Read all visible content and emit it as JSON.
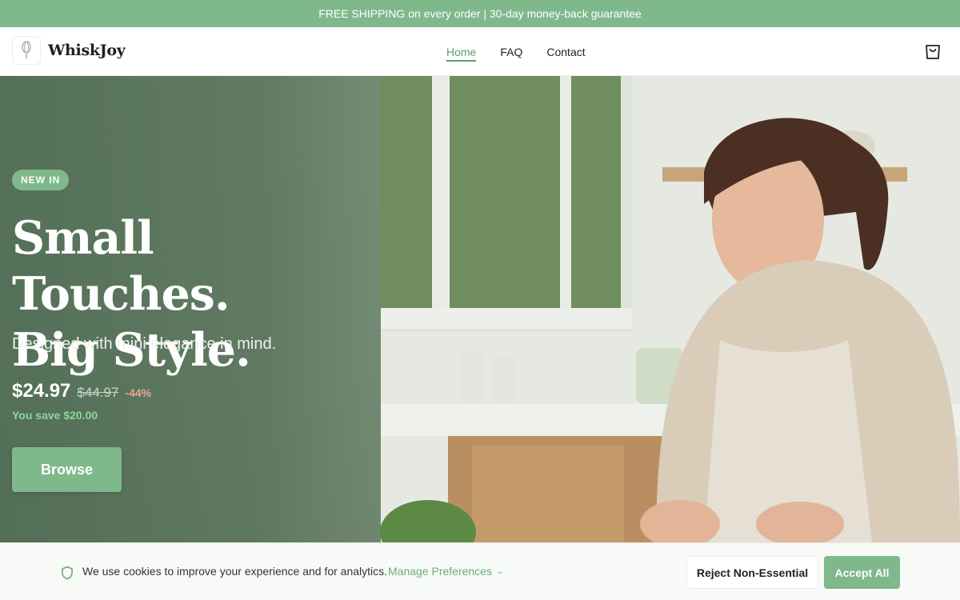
{
  "announcement": "FREE SHIPPING on every order | 30-day money-back guarantee",
  "header": {
    "brand": "WhiskJoy",
    "logo_icon": "whisk-icon",
    "nav": [
      {
        "label": "Home",
        "active": true
      },
      {
        "label": "FAQ",
        "active": false
      },
      {
        "label": "Contact",
        "active": false
      }
    ],
    "cart_icon": "shopping-bag-icon"
  },
  "hero": {
    "badge": "NEW IN",
    "headline_line1": "Small Touches.",
    "headline_line2": "Big Style.",
    "subhead": "Designed with mini elegance in mind.",
    "price_now": "$24.97",
    "price_was": "$44.97",
    "discount": "-44%",
    "saving": "You save $20.00",
    "cta": "Browse"
  },
  "cookie": {
    "icon": "shield-icon",
    "text": "We use cookies to improve your experience and for analytics.",
    "manage": "Manage Preferences",
    "reject": "Reject Non-Essential",
    "accept": "Accept All"
  },
  "colors": {
    "accent": "#7fb88b",
    "accent_dark": "#5d9d6c",
    "hero_overlay": "#4e6b52",
    "discount": "#f0a39a"
  }
}
